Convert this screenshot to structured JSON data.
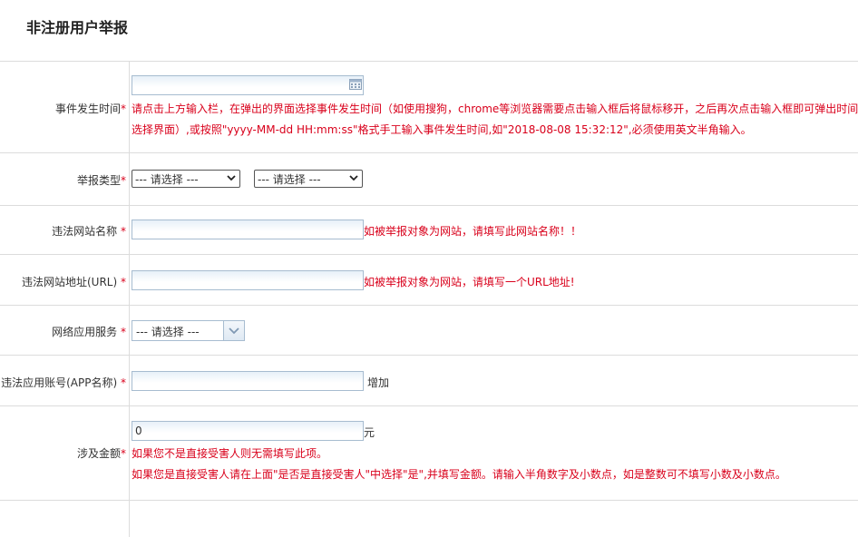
{
  "page_title": "非注册用户举报",
  "rows": {
    "event_time": {
      "label": "事件发生时间",
      "required_mark": "*",
      "input_value": "",
      "hint_line1": "请点击上方输入栏，在弹出的界面选择事件发生时间（如使用搜狗，chrome等浏览器需要点击输入框后将鼠标移开，之后再次点击输入框即可弹出时间",
      "hint_line2": "选择界面）,或按照\"yyyy-MM-dd HH:mm:ss\"格式手工输入事件发生时间,如\"2018-08-08 15:32:12\",必须使用英文半角输入。"
    },
    "report_type": {
      "label": "举报类型",
      "required_mark": "*",
      "select1_value": "--- 请选择 ---",
      "select2_value": "--- 请选择 ---"
    },
    "site_name": {
      "label": "违法网站名称",
      "required_mark": "*",
      "input_value": "",
      "hint": "如被举报对象为网站，请填写此网站名称！！"
    },
    "site_url": {
      "label": "违法网站地址(URL)",
      "required_mark": "*",
      "input_value": "",
      "hint": "如被举报对象为网站，请填写一个URL地址!"
    },
    "app_service": {
      "label": "网络应用服务",
      "required_mark": "*",
      "select_value": "--- 请选择 ---"
    },
    "app_account": {
      "label": "违法应用账号(APP名称)",
      "required_mark": "*",
      "input_value": "",
      "add_label": "增加"
    },
    "amount": {
      "label": "涉及金额",
      "required_mark": "*",
      "input_value": "0",
      "unit": "元",
      "hint_line1": "如果您不是直接受害人则无需填写此项。",
      "hint_line2": "如果您是直接受害人请在上面\"是否是直接受害人\"中选择\"是\",并填写金额。请输入半角数字及小数点，如是整数可不填写小数及小数点。"
    }
  },
  "colors": {
    "required": "#d9001b",
    "border": "#dcdcdc",
    "input_border": "#a7bcd0"
  },
  "icons": {
    "date_picker": "calendar-icon",
    "dropdown": "chevron-down-icon"
  }
}
